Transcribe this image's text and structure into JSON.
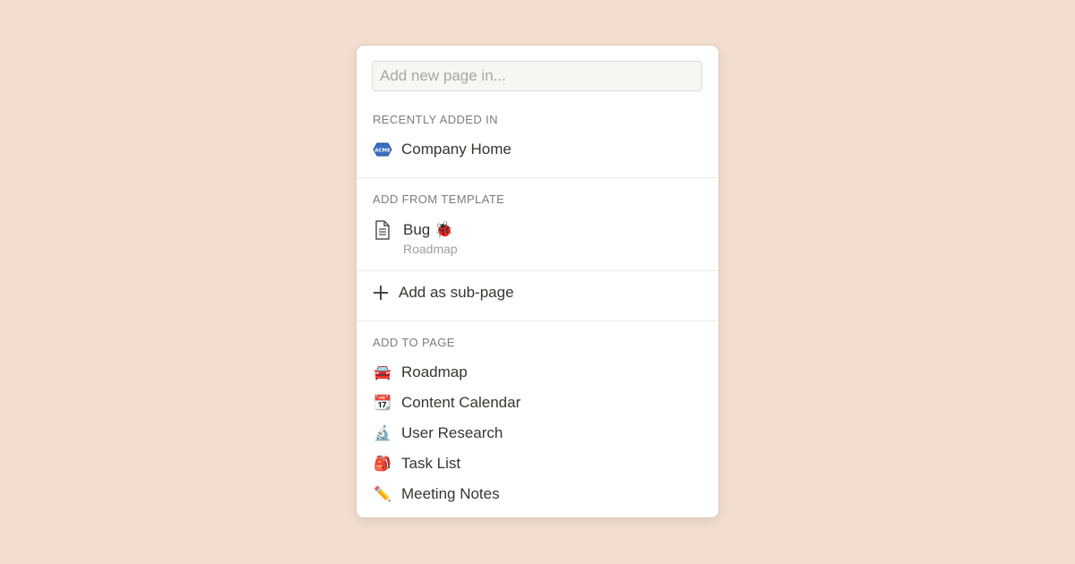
{
  "search": {
    "placeholder": "Add new page in..."
  },
  "recent": {
    "heading": "Recently added in",
    "items": [
      {
        "label": "Company Home",
        "icon": "acme-logo-icon",
        "icon_text": "ACME"
      }
    ]
  },
  "template": {
    "heading": "Add from template",
    "items": [
      {
        "title": "Bug",
        "emoji": "🐞",
        "subtitle": "Roadmap",
        "icon": "document-icon"
      }
    ]
  },
  "subpage": {
    "label": "Add as sub-page",
    "icon": "plus-icon"
  },
  "add_to_page": {
    "heading": "Add to page",
    "items": [
      {
        "label": "Roadmap",
        "emoji": "🚘",
        "icon": "car-icon"
      },
      {
        "label": "Content Calendar",
        "emoji": "📆",
        "icon": "calendar-icon"
      },
      {
        "label": "User Research",
        "emoji": "🔬",
        "icon": "microscope-icon"
      },
      {
        "label": "Task List",
        "emoji": "🎒",
        "icon": "backpack-icon"
      },
      {
        "label": "Meeting Notes",
        "emoji": "✏️",
        "icon": "pencil-icon"
      }
    ]
  },
  "colors": {
    "background": "#f2ddcf",
    "panel": "#ffffff",
    "text": "#37352f",
    "muted": "#7d7c78",
    "acme_blue": "#3b6fc4"
  }
}
